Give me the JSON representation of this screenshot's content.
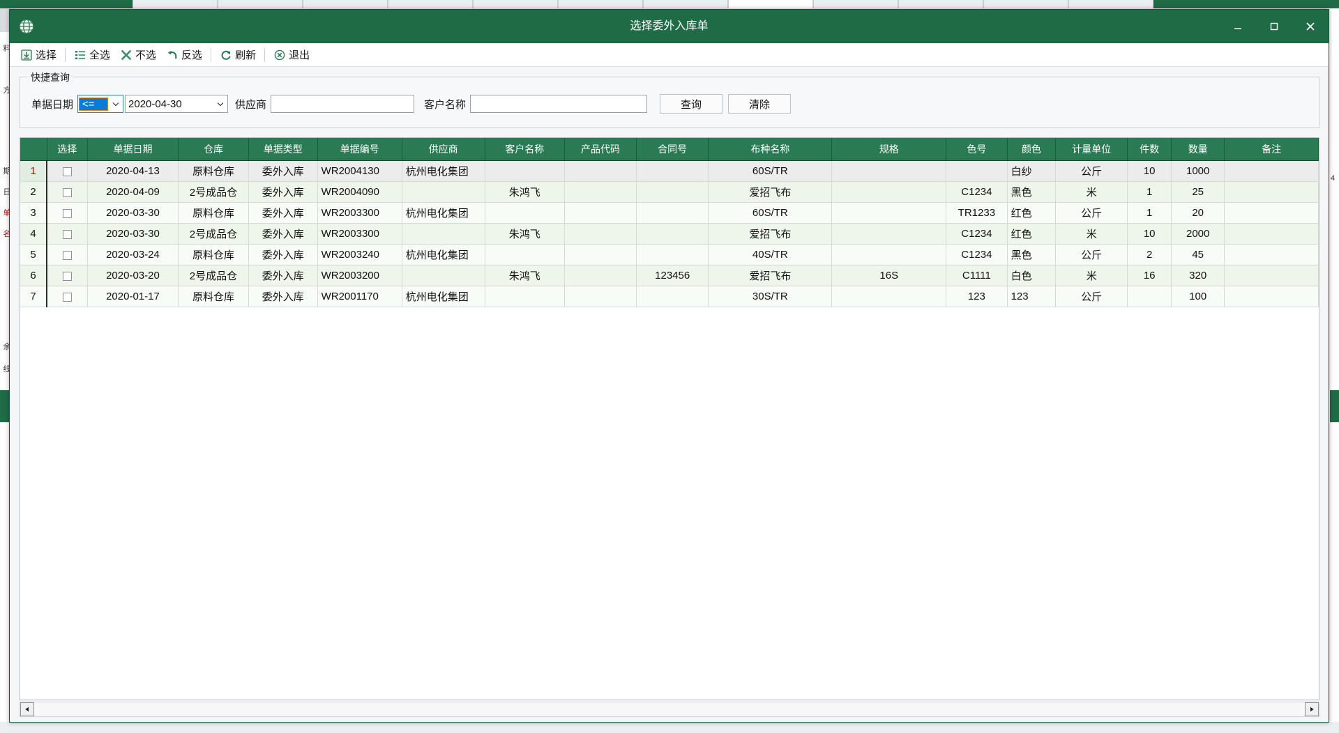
{
  "window": {
    "title": "选择委外入库单",
    "icon": "globe-icon",
    "minimize": "–",
    "maximize": "❐",
    "close": "✕",
    "accent_green": "#1e6b46",
    "header_green": "#2a7a54"
  },
  "toolbar": {
    "items": [
      {
        "label": "选择",
        "icon": "download-box-icon"
      },
      {
        "label": "全选",
        "icon": "list-check-icon"
      },
      {
        "label": "不选",
        "icon": "cross-icon"
      },
      {
        "label": "反选",
        "icon": "undo-arrow-icon"
      },
      {
        "label": "刷新",
        "icon": "refresh-icon"
      },
      {
        "label": "退出",
        "icon": "exit-circle-icon"
      }
    ]
  },
  "quick_query": {
    "legend": "快捷查询",
    "date_label": "单据日期",
    "operator": "<=",
    "operator_options": [
      "<=",
      ">=",
      "=",
      "<",
      ">"
    ],
    "date_value": "2020-04-30",
    "supplier_label": "供应商",
    "supplier_value": "",
    "supplier_placeholder": "",
    "customer_label": "客户名称",
    "customer_value": "",
    "customer_placeholder": "",
    "query_button": "查询",
    "clear_button": "清除"
  },
  "grid": {
    "columns": [
      "选择",
      "单据日期",
      "仓库",
      "单据类型",
      "单据编号",
      "供应商",
      "客户名称",
      "产品代码",
      "合同号",
      "布种名称",
      "规格",
      "色号",
      "颜色",
      "计量单位",
      "件数",
      "数量",
      "备注"
    ],
    "rows": [
      {
        "num": "1",
        "checked": false,
        "selected": true,
        "date": "2020-04-13",
        "warehouse": "原料仓库",
        "doc_type": "委外入库",
        "doc_no": "WR2004130",
        "supplier": "杭州电化集团",
        "customer": "",
        "product_code": "",
        "contract_no": "",
        "fabric": "60S/TR",
        "spec": "",
        "color_no": "",
        "color": "白纱",
        "unit": "公斤",
        "pieces": "10",
        "quantity": "1000",
        "remark": ""
      },
      {
        "num": "2",
        "checked": false,
        "selected": false,
        "date": "2020-04-09",
        "warehouse": "2号成品仓",
        "doc_type": "委外入库",
        "doc_no": "WR2004090",
        "supplier": "",
        "customer": "朱鸿飞",
        "product_code": "",
        "contract_no": "",
        "fabric": "爱招飞布",
        "spec": "",
        "color_no": "C1234",
        "color": "黑色",
        "unit": "米",
        "pieces": "1",
        "quantity": "25",
        "remark": ""
      },
      {
        "num": "3",
        "checked": false,
        "selected": false,
        "date": "2020-03-30",
        "warehouse": "原料仓库",
        "doc_type": "委外入库",
        "doc_no": "WR2003300",
        "supplier": "杭州电化集团",
        "customer": "",
        "product_code": "",
        "contract_no": "",
        "fabric": "60S/TR",
        "spec": "",
        "color_no": "TR1233",
        "color": "红色",
        "unit": "公斤",
        "pieces": "1",
        "quantity": "20",
        "remark": ""
      },
      {
        "num": "4",
        "checked": false,
        "selected": false,
        "date": "2020-03-30",
        "warehouse": "2号成品仓",
        "doc_type": "委外入库",
        "doc_no": "WR2003300",
        "supplier": "",
        "customer": "朱鸿飞",
        "product_code": "",
        "contract_no": "",
        "fabric": "爱招飞布",
        "spec": "",
        "color_no": "C1234",
        "color": "红色",
        "unit": "米",
        "pieces": "10",
        "quantity": "2000",
        "remark": ""
      },
      {
        "num": "5",
        "checked": false,
        "selected": false,
        "date": "2020-03-24",
        "warehouse": "原料仓库",
        "doc_type": "委外入库",
        "doc_no": "WR2003240",
        "supplier": "杭州电化集团",
        "customer": "",
        "product_code": "",
        "contract_no": "",
        "fabric": "40S/TR",
        "spec": "",
        "color_no": "C1234",
        "color": "黑色",
        "unit": "公斤",
        "pieces": "2",
        "quantity": "45",
        "remark": ""
      },
      {
        "num": "6",
        "checked": false,
        "selected": false,
        "date": "2020-03-20",
        "warehouse": "2号成品仓",
        "doc_type": "委外入库",
        "doc_no": "WR2003200",
        "supplier": "",
        "customer": "朱鸿飞",
        "product_code": "",
        "contract_no": "123456",
        "fabric": "爱招飞布",
        "spec": "16S",
        "color_no": "C1111",
        "color": "白色",
        "unit": "米",
        "pieces": "16",
        "quantity": "320",
        "remark": ""
      },
      {
        "num": "7",
        "checked": false,
        "selected": false,
        "date": "2020-01-17",
        "warehouse": "原料仓库",
        "doc_type": "委外入库",
        "doc_no": "WR2001170",
        "supplier": "杭州电化集团",
        "customer": "",
        "product_code": "",
        "contract_no": "",
        "fabric": "30S/TR",
        "spec": "",
        "color_no": "123",
        "color": "123",
        "unit": "公斤",
        "pieces": "",
        "quantity": "100",
        "remark": ""
      }
    ]
  },
  "scrollbar": {
    "left_arrow": "◄",
    "right_arrow": "►"
  },
  "background": {
    "left_strip": [
      "料",
      "方",
      "期",
      "日",
      "单",
      "名",
      "余",
      "线"
    ],
    "right_strip": [
      "4"
    ]
  }
}
